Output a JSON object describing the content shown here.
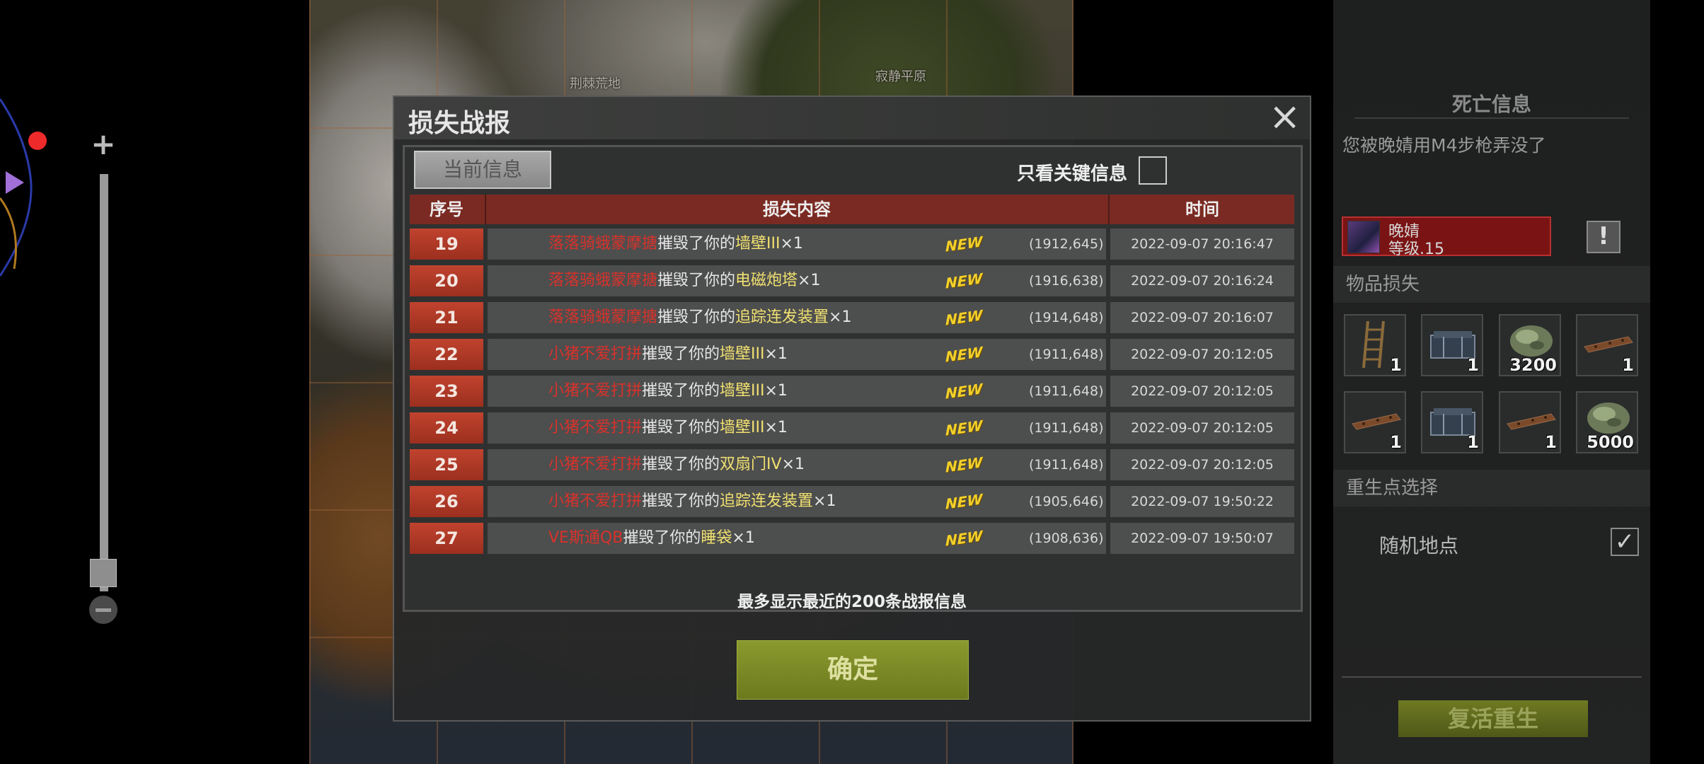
{
  "map": {
    "labels": [
      "寂静平原",
      "荆棘荒地"
    ]
  },
  "zoom": {
    "plus_icon": "+",
    "minus_icon": "minus-icon"
  },
  "dialog": {
    "title": "损失战报",
    "close_icon": "×",
    "tab_current": "当前信息",
    "key_only_label": "只看关键信息",
    "key_only_checked": false,
    "columns": {
      "index": "序号",
      "content": "损失内容",
      "time": "时间"
    },
    "new_badge": "NEW",
    "rows": [
      {
        "index": "19",
        "attacker": "落落骑蛾蒙摩搪",
        "verb": "摧毁了你的",
        "item": "墙壁III",
        "qty": "×1",
        "coord": "(1912,645)",
        "time": "2022-09-07 20:16:47"
      },
      {
        "index": "20",
        "attacker": "落落骑蛾蒙摩搪",
        "verb": "摧毁了你的",
        "item": "电磁炮塔",
        "qty": "×1",
        "coord": "(1916,638)",
        "time": "2022-09-07 20:16:24"
      },
      {
        "index": "21",
        "attacker": "落落骑蛾蒙摩搪",
        "verb": "摧毁了你的",
        "item": "追踪连发装置",
        "qty": "×1",
        "coord": "(1914,648)",
        "time": "2022-09-07 20:16:07"
      },
      {
        "index": "22",
        "attacker": "小猪不爱打拼",
        "verb": "摧毁了你的",
        "item": "墙壁III",
        "qty": "×1",
        "coord": "(1911,648)",
        "time": "2022-09-07 20:12:05"
      },
      {
        "index": "23",
        "attacker": "小猪不爱打拼",
        "verb": "摧毁了你的",
        "item": "墙壁III",
        "qty": "×1",
        "coord": "(1911,648)",
        "time": "2022-09-07 20:12:05"
      },
      {
        "index": "24",
        "attacker": "小猪不爱打拼",
        "verb": "摧毁了你的",
        "item": "墙壁III",
        "qty": "×1",
        "coord": "(1911,648)",
        "time": "2022-09-07 20:12:05"
      },
      {
        "index": "25",
        "attacker": "小猪不爱打拼",
        "verb": "摧毁了你的",
        "item": "双扇门IV",
        "qty": "×1",
        "coord": "(1911,648)",
        "time": "2022-09-07 20:12:05"
      },
      {
        "index": "26",
        "attacker": "小猪不爱打拼",
        "verb": "摧毁了你的",
        "item": "追踪连发装置",
        "qty": "×1",
        "coord": "(1905,646)",
        "time": "2022-09-07 19:50:22"
      },
      {
        "index": "27",
        "attacker": "VE斯通QB",
        "verb": "摧毁了你的",
        "item": "睡袋",
        "qty": "×1",
        "coord": "(1908,636)",
        "time": "2022-09-07 19:50:07"
      }
    ],
    "footer_note": "最多显示最近的200条战报信息",
    "confirm_label": "确定"
  },
  "death_panel": {
    "title": "死亡信息",
    "message": "您被晚婧用M4步枪弄没了",
    "killer_name": "晚婧",
    "killer_level": "等级.15",
    "report_icon": "!",
    "items_lost_label": "物品损失",
    "items": [
      {
        "icon": "ladder-icon",
        "qty": "1"
      },
      {
        "icon": "crate-icon",
        "qty": "1"
      },
      {
        "icon": "ore-icon",
        "qty": "3200"
      },
      {
        "icon": "plank-icon",
        "qty": "1"
      },
      {
        "icon": "plank-icon",
        "qty": "1"
      },
      {
        "icon": "crate-icon",
        "qty": "1"
      },
      {
        "icon": "plank-icon",
        "qty": "1"
      },
      {
        "icon": "ore-icon",
        "qty": "5000"
      }
    ],
    "respawn_label": "重生点选择",
    "random_location_label": "随机地点",
    "random_location_checked": true,
    "check_glyph": "✓",
    "revive_label": "复活重生"
  }
}
